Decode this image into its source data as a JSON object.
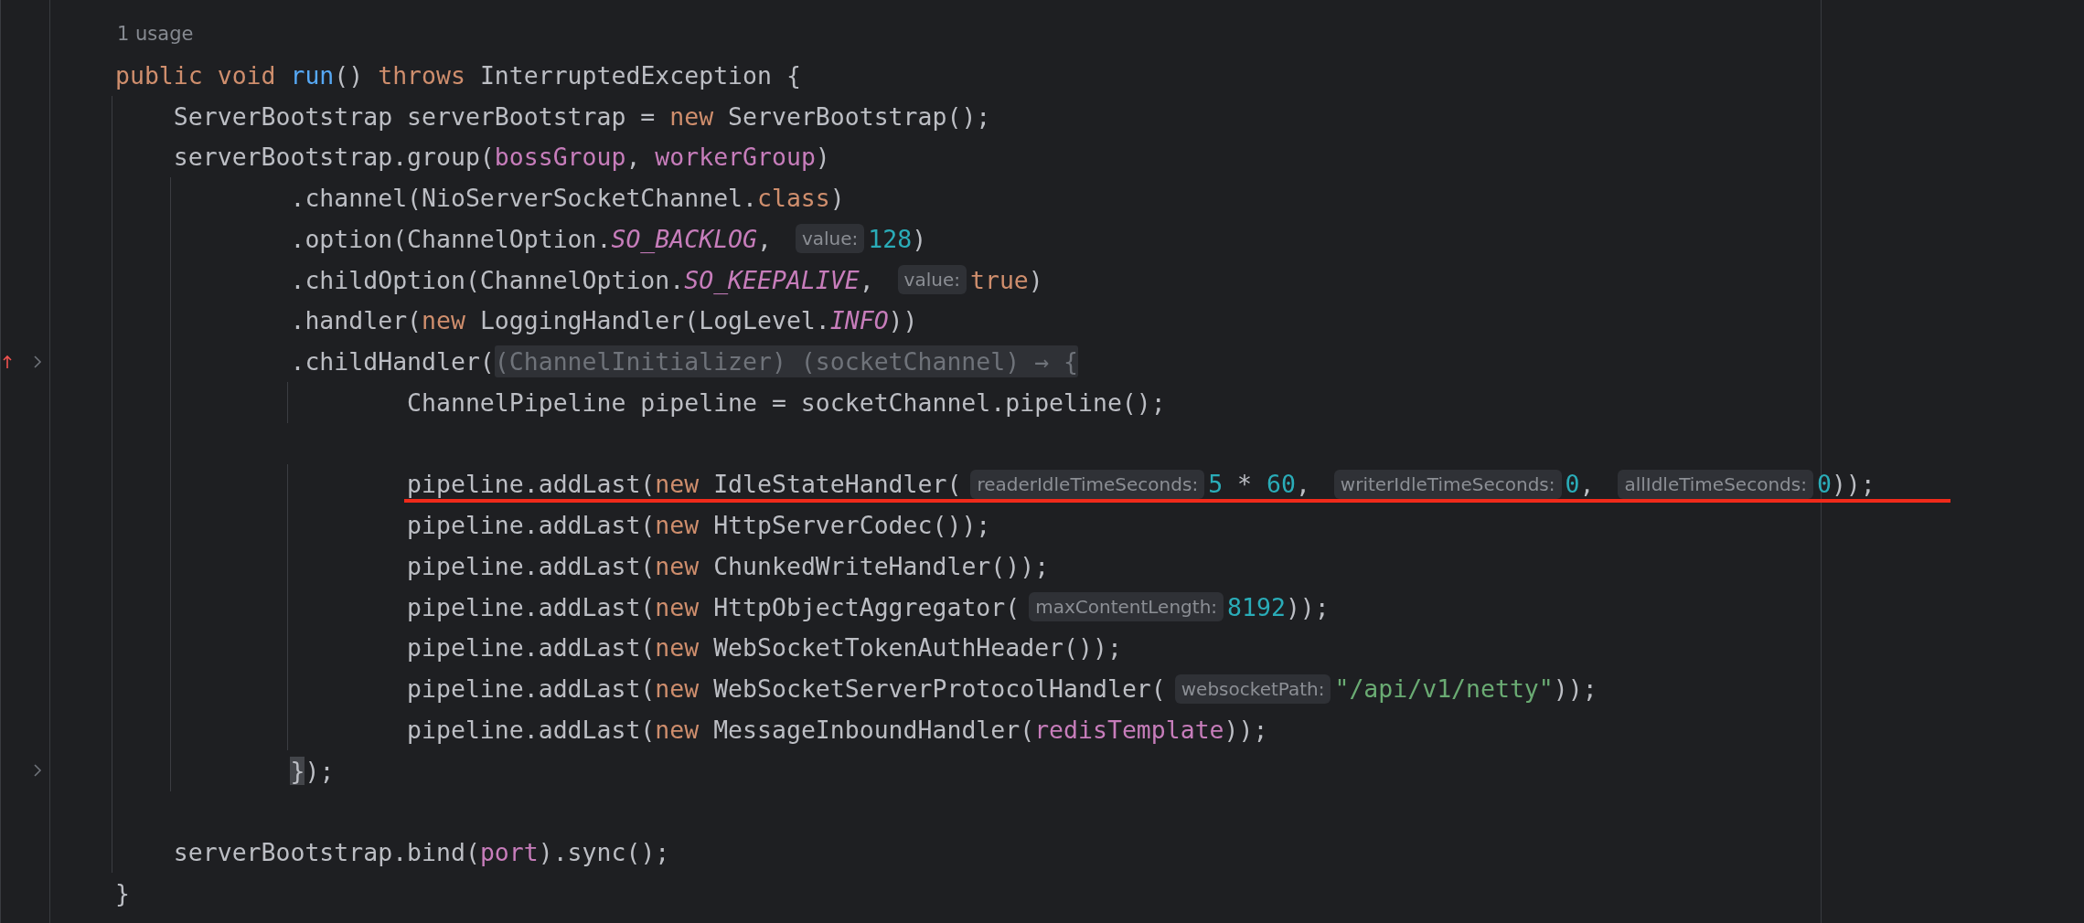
{
  "usages": "1 usage",
  "lines": [
    {
      "kind": "code",
      "tokens": [
        {
          "kind": "keyword",
          "text": "public void "
        },
        {
          "kind": "method",
          "text": "run"
        },
        {
          "kind": "plain",
          "text": "() "
        },
        {
          "kind": "keyword",
          "text": "throws "
        },
        {
          "kind": "plain",
          "text": "InterruptedException {"
        }
      ]
    },
    {
      "kind": "code",
      "tokens": [
        {
          "kind": "plain",
          "text": "    ServerBootstrap serverBootstrap = "
        },
        {
          "kind": "keyword",
          "text": "new "
        },
        {
          "kind": "plain",
          "text": "ServerBootstrap();"
        }
      ]
    },
    {
      "kind": "code",
      "tokens": [
        {
          "kind": "plain",
          "text": "    serverBootstrap.group("
        },
        {
          "kind": "field",
          "text": "bossGroup"
        },
        {
          "kind": "plain",
          "text": ", "
        },
        {
          "kind": "field",
          "text": "workerGroup"
        },
        {
          "kind": "plain",
          "text": ")"
        }
      ]
    },
    {
      "kind": "code",
      "tokens": [
        {
          "kind": "plain",
          "text": "            .channel(NioServerSocketChannel."
        },
        {
          "kind": "keyword",
          "text": "class"
        },
        {
          "kind": "plain",
          "text": ")"
        }
      ]
    },
    {
      "kind": "code",
      "tokens": [
        {
          "kind": "plain",
          "text": "            .option(ChannelOption."
        },
        {
          "kind": "static",
          "text": "SO_BACKLOG"
        },
        {
          "kind": "plain",
          "text": ", "
        },
        {
          "kind": "hint",
          "text": "value:"
        },
        {
          "kind": "number",
          "text": "128"
        },
        {
          "kind": "plain",
          "text": ")"
        }
      ]
    },
    {
      "kind": "code",
      "tokens": [
        {
          "kind": "plain",
          "text": "            .childOption(ChannelOption."
        },
        {
          "kind": "static",
          "text": "SO_KEEPALIVE"
        },
        {
          "kind": "plain",
          "text": ", "
        },
        {
          "kind": "hint",
          "text": "value:"
        },
        {
          "kind": "keyword",
          "text": "true"
        },
        {
          "kind": "plain",
          "text": ")"
        }
      ]
    },
    {
      "kind": "code",
      "tokens": [
        {
          "kind": "plain",
          "text": "            .handler("
        },
        {
          "kind": "keyword",
          "text": "new "
        },
        {
          "kind": "plain",
          "text": "LoggingHandler(LogLevel."
        },
        {
          "kind": "static",
          "text": "INFO"
        },
        {
          "kind": "plain",
          "text": "))"
        }
      ]
    },
    {
      "kind": "code",
      "change_marker": true,
      "fold": true,
      "tokens": [
        {
          "kind": "plain",
          "text": "            .childHandler("
        },
        {
          "kind": "lambda-hint",
          "text": "(ChannelInitializer) (socketChannel) → {"
        }
      ]
    },
    {
      "kind": "code",
      "tokens": [
        {
          "kind": "plain",
          "text": "                    ChannelPipeline pipeline = socketChannel.pipeline();"
        }
      ]
    },
    {
      "kind": "blank"
    },
    {
      "kind": "code",
      "underlined": true,
      "tokens": [
        {
          "kind": "plain",
          "text": "                    pipeline.addLast("
        },
        {
          "kind": "keyword",
          "text": "new "
        },
        {
          "kind": "plain",
          "text": "IdleStateHandler("
        },
        {
          "kind": "hint",
          "text": "readerIdleTimeSeconds:"
        },
        {
          "kind": "number",
          "text": "5"
        },
        {
          "kind": "plain",
          "text": " * "
        },
        {
          "kind": "number",
          "text": "60"
        },
        {
          "kind": "plain",
          "text": ", "
        },
        {
          "kind": "hint",
          "text": "writerIdleTimeSeconds:"
        },
        {
          "kind": "number",
          "text": "0"
        },
        {
          "kind": "plain",
          "text": ", "
        },
        {
          "kind": "hint",
          "text": "allIdleTimeSeconds:"
        },
        {
          "kind": "number",
          "text": "0"
        },
        {
          "kind": "plain",
          "text": "));"
        }
      ]
    },
    {
      "kind": "code",
      "tokens": [
        {
          "kind": "plain",
          "text": "                    pipeline.addLast("
        },
        {
          "kind": "keyword",
          "text": "new "
        },
        {
          "kind": "plain",
          "text": "HttpServerCodec());"
        }
      ]
    },
    {
      "kind": "code",
      "tokens": [
        {
          "kind": "plain",
          "text": "                    pipeline.addLast("
        },
        {
          "kind": "keyword",
          "text": "new "
        },
        {
          "kind": "plain",
          "text": "ChunkedWriteHandler());"
        }
      ]
    },
    {
      "kind": "code",
      "tokens": [
        {
          "kind": "plain",
          "text": "                    pipeline.addLast("
        },
        {
          "kind": "keyword",
          "text": "new "
        },
        {
          "kind": "plain",
          "text": "HttpObjectAggregator("
        },
        {
          "kind": "hint",
          "text": "maxContentLength:"
        },
        {
          "kind": "number",
          "text": "8192"
        },
        {
          "kind": "plain",
          "text": "));"
        }
      ]
    },
    {
      "kind": "code",
      "tokens": [
        {
          "kind": "plain",
          "text": "                    pipeline.addLast("
        },
        {
          "kind": "keyword",
          "text": "new "
        },
        {
          "kind": "plain",
          "text": "WebSocketTokenAuthHeader());"
        }
      ]
    },
    {
      "kind": "code",
      "tokens": [
        {
          "kind": "plain",
          "text": "                    pipeline.addLast("
        },
        {
          "kind": "keyword",
          "text": "new "
        },
        {
          "kind": "plain",
          "text": "WebSocketServerProtocolHandler("
        },
        {
          "kind": "hint",
          "text": "websocketPath:"
        },
        {
          "kind": "string",
          "text": "\"/api/v1/netty\""
        },
        {
          "kind": "plain",
          "text": "));"
        }
      ]
    },
    {
      "kind": "code",
      "tokens": [
        {
          "kind": "plain",
          "text": "                    pipeline.addLast("
        },
        {
          "kind": "keyword",
          "text": "new "
        },
        {
          "kind": "plain",
          "text": "MessageInboundHandler("
        },
        {
          "kind": "field",
          "text": "redisTemplate"
        },
        {
          "kind": "plain",
          "text": "));"
        }
      ]
    },
    {
      "kind": "code",
      "fold": true,
      "tokens": [
        {
          "kind": "brace-match",
          "text": "            }"
        },
        {
          "kind": "plain",
          "text": ");"
        }
      ]
    },
    {
      "kind": "blank"
    },
    {
      "kind": "code",
      "tokens": [
        {
          "kind": "plain",
          "text": "    serverBootstrap.bind("
        },
        {
          "kind": "field",
          "text": "port"
        },
        {
          "kind": "plain",
          "text": ").sync();"
        }
      ]
    },
    {
      "kind": "code",
      "tokens": [
        {
          "kind": "plain",
          "text": "}"
        }
      ]
    }
  ]
}
